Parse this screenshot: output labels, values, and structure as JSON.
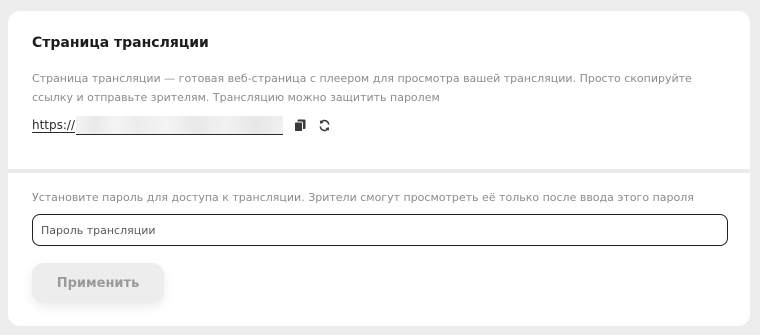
{
  "stream_page": {
    "title": "Страница трансляции",
    "description": "Страница трансляции — готовая веб-страница с плеером для просмотра вашей трансляции. Просто скопируйте ссылку и отправьте зрителям. Трансляцию можно защитить паролем",
    "url_prefix": "https://",
    "copy_icon": "copy-icon",
    "refresh_icon": "refresh-icon"
  },
  "password": {
    "hint": "Установите пароль для доступа к трансляции. Зрители смогут просмотреть её только после ввода этого пароля",
    "placeholder": "Пароль трансляции",
    "value": ""
  },
  "apply_button": {
    "label": "Применить"
  },
  "colors": {
    "background": "#ededed",
    "card": "#ffffff",
    "title": "#1c1c1c",
    "muted_text": "#8c8c8c",
    "button_bg": "#ededed",
    "button_text": "#9a9a9a",
    "input_border": "#1f1f1f"
  }
}
